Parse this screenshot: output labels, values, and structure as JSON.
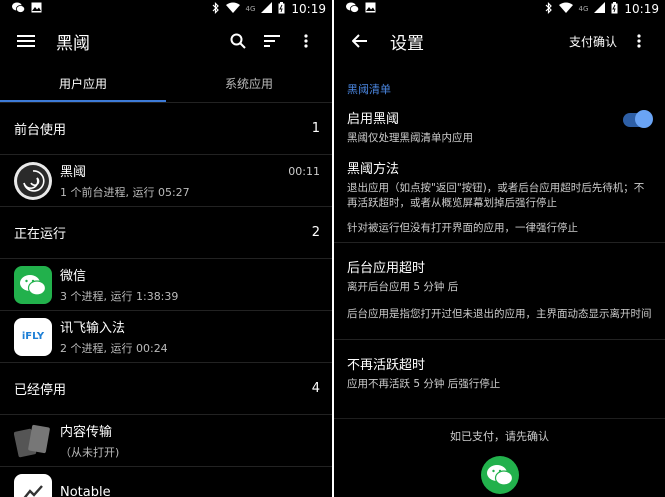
{
  "status_bar": {
    "time": "10:19",
    "network": "4G",
    "left_icons": [
      "wechat-icon",
      "image-icon"
    ],
    "right_icons": [
      "bluetooth-icon",
      "wifi-icon",
      "signal-icon",
      "battery-icon"
    ]
  },
  "left": {
    "toolbar": {
      "title": "黑阈",
      "icons": [
        "menu-icon",
        "search-icon",
        "sort-icon",
        "more-vert-icon"
      ]
    },
    "tabs": [
      {
        "label": "用户应用",
        "active": true
      },
      {
        "label": "系统应用",
        "active": false
      }
    ],
    "sections": [
      {
        "title": "前台使用",
        "count": "1",
        "apps": [
          {
            "name": "黑阈",
            "sub": "1 个前台进程, 运行 05:27",
            "time": "00:11",
            "icon": "heiyu-icon"
          }
        ]
      },
      {
        "title": "正在运行",
        "count": "2",
        "apps": [
          {
            "name": "微信",
            "sub": "3 个进程, 运行 1:38:39",
            "icon": "wechat-icon"
          },
          {
            "name": "讯飞输入法",
            "sub": "2 个进程, 运行 00:24",
            "icon": "ifly-icon",
            "icon_text": "iFLY"
          }
        ]
      },
      {
        "title": "已经停用",
        "count": "4",
        "apps": [
          {
            "name": "内容传输",
            "sub": "（从未打开)",
            "icon": "transfer-icon"
          },
          {
            "name": "Notable",
            "sub": "",
            "icon": "notable-icon"
          }
        ]
      }
    ]
  },
  "right": {
    "toolbar": {
      "title": "设置",
      "action": "支付确认",
      "icons": [
        "back-arrow-icon",
        "more-vert-icon"
      ]
    },
    "category": "黑阈清单",
    "items": [
      {
        "title": "启用黑阈",
        "desc": "黑阈仅处理黑阈清单内应用",
        "toggle": true
      },
      {
        "title": "黑阈方法",
        "desc": "退出应用（如点按\"返回\"按钮)，或者后台应用超时后先待机；不再活跃超时，或者从概览屏幕划掉后强行停止",
        "note": "针对被运行但没有打开界面的应用，一律强行停止"
      },
      {
        "title": "后台应用超时",
        "desc": "离开后台应用 5 分钟 后",
        "note": "后台应用是指您打开过但未退出的应用，主界面动态显示离开时间"
      },
      {
        "title": "不再活跃超时",
        "desc": "应用不再活跃 5 分钟 后强行停止"
      }
    ],
    "footer": {
      "text": "如已支付，请先确认",
      "button_icon": "wechat-pay-icon"
    }
  },
  "colors": {
    "accent": "#3d7bd8",
    "category": "#4a86e0",
    "wechat": "#22b14c",
    "background": "#000000"
  }
}
